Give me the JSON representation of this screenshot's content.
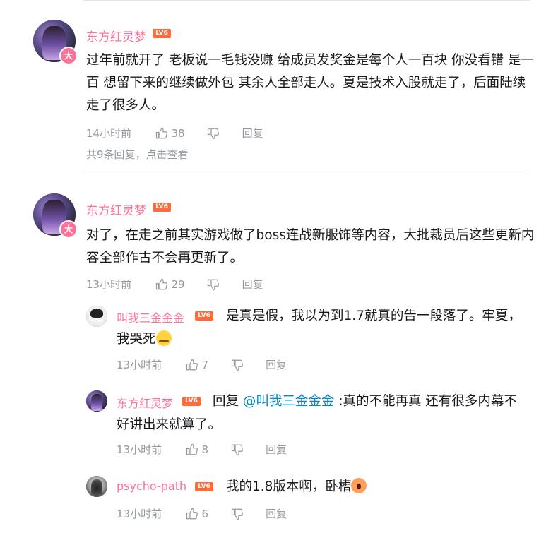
{
  "comments": [
    {
      "username": "东方红灵梦",
      "level": "LV6",
      "badge": "大",
      "text": "过年前就开了 老板说一毛钱没赚 给成员发奖金是每个人一百块 你没看错 是一百 想留下来的继续做外包 其余人全部走人。夏是技术入股就走了，后面陆续走了很多人。",
      "time": "14小时前",
      "likes": "38",
      "reply_label": "回复",
      "more_replies": "共9条回复，点击查看"
    },
    {
      "username": "东方红灵梦",
      "level": "LV6",
      "badge": "大",
      "text": "对了，在走之前其实游戏做了boss连战新服饰等内容，大批裁员后这些更新内容全部作古不会再更新了。",
      "time": "13小时前",
      "likes": "29",
      "reply_label": "回复"
    }
  ],
  "replies": [
    {
      "username": "叫我三金金金",
      "level": "LV6",
      "text_line1": "是真是假，我以为到1.7就真的告一段落了。牢夏，",
      "text_line2": "我哭死",
      "emoji": "cry-emoji",
      "time": "13小时前",
      "likes": "7",
      "reply_label": "回复"
    },
    {
      "username": "东方红灵梦",
      "level": "LV6",
      "reply_prefix": "回复",
      "mention": "@叫我三金金金",
      "text_line1": ":真的不能再真 还有很多内幕不",
      "text_line2": "好讲出来就算了。",
      "time": "13小时前",
      "likes": "8",
      "reply_label": "回复"
    },
    {
      "username": "psycho-path",
      "level": "LV6",
      "text_line1": "我的1.8版本啊，卧槽",
      "emoji": "scream-emoji",
      "time": "13小时前",
      "likes": "6",
      "reply_label": "回复"
    }
  ]
}
